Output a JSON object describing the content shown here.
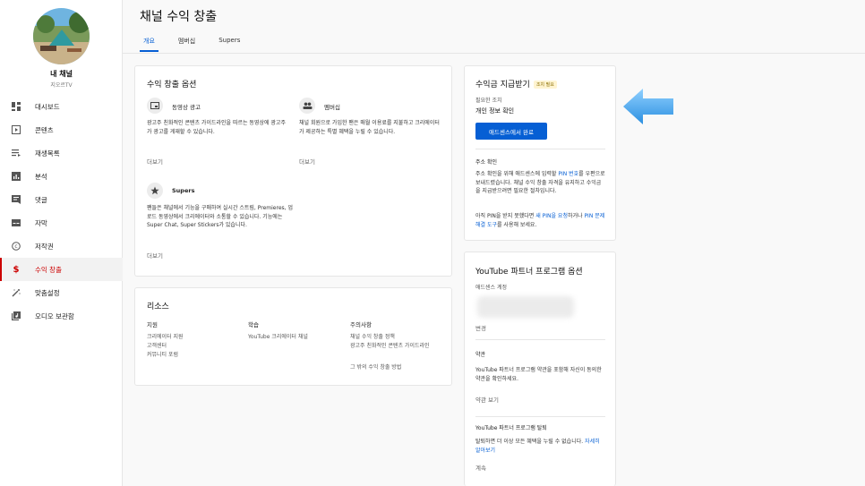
{
  "channel": {
    "name": "내 채널",
    "handle": "지오르TV"
  },
  "nav": [
    {
      "label": "대시보드",
      "icon": "dashboard-icon"
    },
    {
      "label": "콘텐츠",
      "icon": "content-icon"
    },
    {
      "label": "재생목록",
      "icon": "playlist-icon"
    },
    {
      "label": "분석",
      "icon": "analytics-icon"
    },
    {
      "label": "댓글",
      "icon": "comments-icon"
    },
    {
      "label": "자막",
      "icon": "subtitles-icon"
    },
    {
      "label": "저작권",
      "icon": "copyright-icon"
    },
    {
      "label": "수익 창출",
      "icon": "dollar-icon",
      "active": true
    },
    {
      "label": "맞춤설정",
      "icon": "magic-wand-icon"
    },
    {
      "label": "오디오 보관함",
      "icon": "audio-library-icon"
    }
  ],
  "page": {
    "title": "채널 수익 창출"
  },
  "tabs": [
    {
      "label": "개요",
      "active": true
    },
    {
      "label": "멤버십"
    },
    {
      "label": "Supers"
    }
  ],
  "options_card": {
    "title": "수익 창출 옵션",
    "video_ads": {
      "name": "동영상 광고",
      "desc": "광고주 친화적인 콘텐츠 가이드라인을 따르는 동영상에 광고주가 광고를 게재할 수 있습니다.",
      "more": "더보기"
    },
    "membership": {
      "name": "멤버십",
      "desc": "채널 회원으로 가입한 팬은 매월 이용료를 지불하고 크리에이터가 제공하는 특별 혜택을 누릴 수 있습니다.",
      "more": "더보기"
    },
    "supers": {
      "name": "Supers",
      "desc": "팬들은 채널에서 기능을 구매하여 실시간 스트림, Premieres, 업로드 동영상에서 크리에이터와 소통할 수 있습니다. 기능에는 Super Chat, Super Stickers가 있습니다.",
      "more": "더보기"
    }
  },
  "resources": {
    "title": "리소스",
    "support": {
      "heading": "지원",
      "links": [
        "크리에이터 지원",
        "고객센터",
        "커뮤니티 포럼"
      ]
    },
    "learning": {
      "heading": "학습",
      "links": [
        "YouTube 크리에이터 채널"
      ]
    },
    "notes": {
      "heading": "주의사항",
      "links": [
        "채널 수익 창출 정책",
        "광고주 친화적인 콘텐츠 가이드라인",
        "그 밖의 수익 창출 방법"
      ]
    }
  },
  "payment": {
    "title": "수익금 지급받기",
    "badge": "조치 필요",
    "required_label": "필요한 조치",
    "required_action": "개인 정보 확인",
    "button": "애드센스에서 완료",
    "address_heading": "주소 확인",
    "address_p1_a": "주소 확인을 위해 애드센스에 입력할 ",
    "address_p1_link": "PIN 번호",
    "address_p1_b": "를 우편으로 보내드렸습니다. 채널 수익 창출 자격을 유지하고 수익금을 지급받으려면 필요한 절차입니다.",
    "address_p2_a": "아직 PIN을 받지 못했다면 ",
    "address_p2_link1": "새 PIN을 요청",
    "address_p2_b": "하거나 ",
    "address_p2_link2": "PIN 문제 해결 도구",
    "address_p2_c": "를 사용해 보세요."
  },
  "ypp": {
    "title": "YouTube 파트너 프로그램 옵션",
    "adsense_label": "애드센스 계정",
    "change": "변경",
    "terms_heading": "약관",
    "terms_desc": "YouTube 파트너 프로그램 약관을 포함해 자신이 동의한 약관을 확인하세요.",
    "terms_link": "약관 보기",
    "leave_heading": "YouTube 파트너 프로그램 탈퇴",
    "leave_desc_a": "탈퇴하면 더 이상 모든 혜택을 누릴 수 없습니다. ",
    "leave_desc_link": "자세히 알아보기",
    "leave_continue": "계속"
  },
  "colors": {
    "accent": "#065fd4",
    "active_nav": "#cc0000",
    "arrow": "#3d9fe8"
  }
}
